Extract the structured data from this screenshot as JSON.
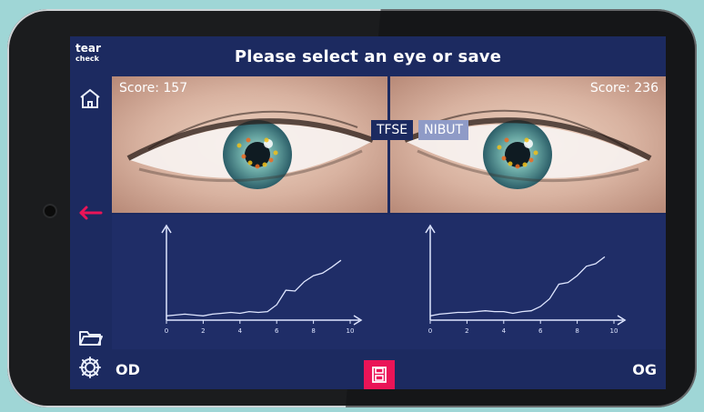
{
  "app": {
    "logo_line1": "tear",
    "logo_line2": "check",
    "title": "Please select an eye or save"
  },
  "eyes": {
    "left": {
      "label": "OD",
      "score_label": "Score: 157"
    },
    "right": {
      "label": "OG",
      "score_label": "Score: 236"
    }
  },
  "mode_tabs": [
    {
      "label": "TFSE",
      "active": false
    },
    {
      "label": "NIBUT",
      "active": true
    }
  ],
  "charts": {
    "left": {
      "x_ticks": [
        "0",
        "2",
        "4",
        "6",
        "8",
        "10"
      ]
    },
    "right": {
      "x_ticks": [
        "0",
        "2",
        "4",
        "6",
        "8",
        "10"
      ]
    }
  },
  "chart_data": [
    {
      "type": "line",
      "x": [
        0,
        0.5,
        1,
        1.5,
        2,
        2.5,
        3,
        3.5,
        4,
        4.5,
        5,
        5.5,
        6,
        6.5,
        7,
        7.5,
        8,
        8.5,
        9,
        9.5
      ],
      "y": [
        0.05,
        0.06,
        0.07,
        0.06,
        0.05,
        0.07,
        0.08,
        0.09,
        0.08,
        0.1,
        0.09,
        0.1,
        0.18,
        0.35,
        0.34,
        0.45,
        0.52,
        0.55,
        0.62,
        0.7
      ],
      "xlim": [
        0,
        10
      ],
      "ylim": [
        0,
        1
      ],
      "xlabel": "",
      "ylabel": "",
      "title": ""
    },
    {
      "type": "line",
      "x": [
        0,
        0.5,
        1,
        1.5,
        2,
        2.5,
        3,
        3.5,
        4,
        4.5,
        5,
        5.5,
        6,
        6.5,
        7,
        7.5,
        8,
        8.5,
        9,
        9.5
      ],
      "y": [
        0.05,
        0.07,
        0.08,
        0.09,
        0.09,
        0.1,
        0.11,
        0.1,
        0.1,
        0.08,
        0.1,
        0.11,
        0.16,
        0.25,
        0.42,
        0.44,
        0.52,
        0.63,
        0.66,
        0.74
      ],
      "xlim": [
        0,
        10
      ],
      "ylim": [
        0,
        1
      ],
      "xlabel": "",
      "ylabel": "",
      "title": ""
    }
  ],
  "colors": {
    "screen_bg": "#1c2a60",
    "accent_pink": "#ea1457",
    "tab_active": "#8f9bc7",
    "line_color": "#dfe6ff"
  },
  "icons": {
    "home": "home-icon",
    "back": "arrow-left-icon",
    "folder": "folder-icon",
    "settings": "gear-icon",
    "save": "floppy-disk-icon"
  }
}
